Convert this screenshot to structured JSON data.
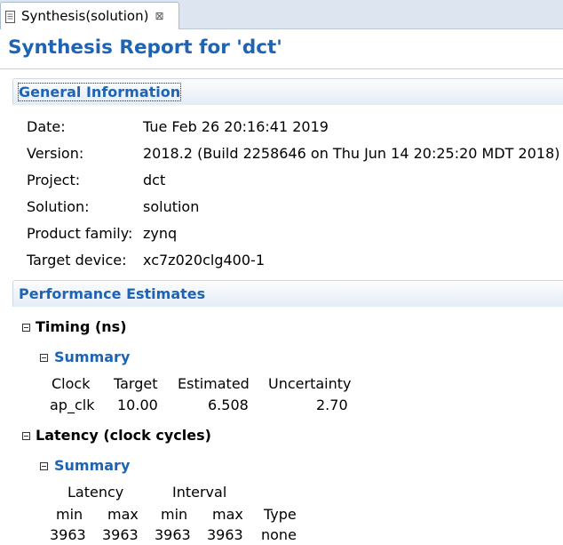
{
  "tab": {
    "icon": "report-document-icon",
    "label": "Synthesis(solution)",
    "close_glyph": "⊠"
  },
  "report": {
    "title": "Synthesis Report for 'dct'"
  },
  "general": {
    "header": "General Information",
    "rows": [
      {
        "label": "Date:",
        "value": "Tue Feb 26 20:16:41 2019"
      },
      {
        "label": "Version:",
        "value": "2018.2 (Build 2258646 on Thu Jun 14 20:25:20 MDT 2018)"
      },
      {
        "label": "Project:",
        "value": "dct"
      },
      {
        "label": "Solution:",
        "value": "solution"
      },
      {
        "label": "Product family:",
        "value": "zynq"
      },
      {
        "label": "Target device:",
        "value": "xc7z020clg400-1"
      }
    ]
  },
  "performance": {
    "header": "Performance Estimates",
    "timing": {
      "heading": "Timing (ns)",
      "summary_heading": "Summary",
      "columns": [
        "Clock",
        "Target",
        "Estimated",
        "Uncertainty"
      ],
      "rows": [
        [
          "ap_clk",
          "10.00",
          "6.508",
          "2.70"
        ]
      ]
    },
    "latency": {
      "heading": "Latency (clock cycles)",
      "summary_heading": "Summary",
      "group_headers": [
        "Latency",
        "Interval"
      ],
      "columns": [
        "min",
        "max",
        "min",
        "max",
        "Type"
      ],
      "rows": [
        [
          "3963",
          "3963",
          "3963",
          "3963",
          "none"
        ]
      ]
    }
  },
  "colors": {
    "accent": "#1f64b4",
    "tab_strip": "#dde6f0"
  }
}
